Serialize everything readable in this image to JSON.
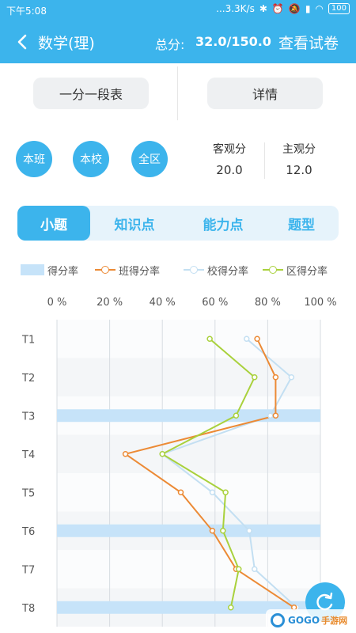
{
  "status_bar": {
    "time": "下午5:08",
    "network": "...3.3K/s",
    "battery": "100"
  },
  "header": {
    "title": "数学(理)",
    "total_label": "总分:",
    "total_value": "32.0/150.0",
    "view_paper": "查看试卷"
  },
  "actions": {
    "segment_table": "一分一段表",
    "detail": "详情"
  },
  "scopes": [
    "本班",
    "本校",
    "全区"
  ],
  "scores": {
    "objective_label": "客观分",
    "objective_value": "20.0",
    "subjective_label": "主观分",
    "subjective_value": "12.0"
  },
  "tabs": {
    "items": [
      "小题",
      "知识点",
      "能力点",
      "题型"
    ],
    "active": 0
  },
  "colors": {
    "primary": "#3cb4ec",
    "bar": "#c6e3f9",
    "class": "#ec8a35",
    "school": "#c3dff2",
    "area": "#a9d13c"
  },
  "watermark": {
    "text": "GOGO",
    "text2": "手游网"
  },
  "chart_data": {
    "type": "bar",
    "orientation": "horizontal",
    "categories": [
      "T1",
      "T2",
      "T3",
      "T4",
      "T5",
      "T6",
      "T7",
      "T8"
    ],
    "xlim": [
      0,
      100
    ],
    "xticks": [
      "0 %",
      "20 %",
      "40 %",
      "60 %",
      "80 %",
      "100 %"
    ],
    "grid": true,
    "legend_position": "top",
    "legend": [
      "得分率",
      "班得分率",
      "校得分率",
      "区得分率"
    ],
    "series": [
      {
        "name": "得分率",
        "kind": "bar",
        "values": [
          0,
          0,
          100,
          0,
          0,
          100,
          0,
          100
        ]
      },
      {
        "name": "班得分率",
        "kind": "line",
        "values": [
          76,
          83,
          83,
          26,
          47,
          59,
          68,
          90
        ]
      },
      {
        "name": "校得分率",
        "kind": "line",
        "values": [
          72,
          89,
          81,
          40,
          59,
          73,
          75,
          91
        ]
      },
      {
        "name": "区得分率",
        "kind": "line",
        "values": [
          58,
          75,
          68,
          40,
          64,
          63,
          69,
          66
        ]
      }
    ]
  }
}
